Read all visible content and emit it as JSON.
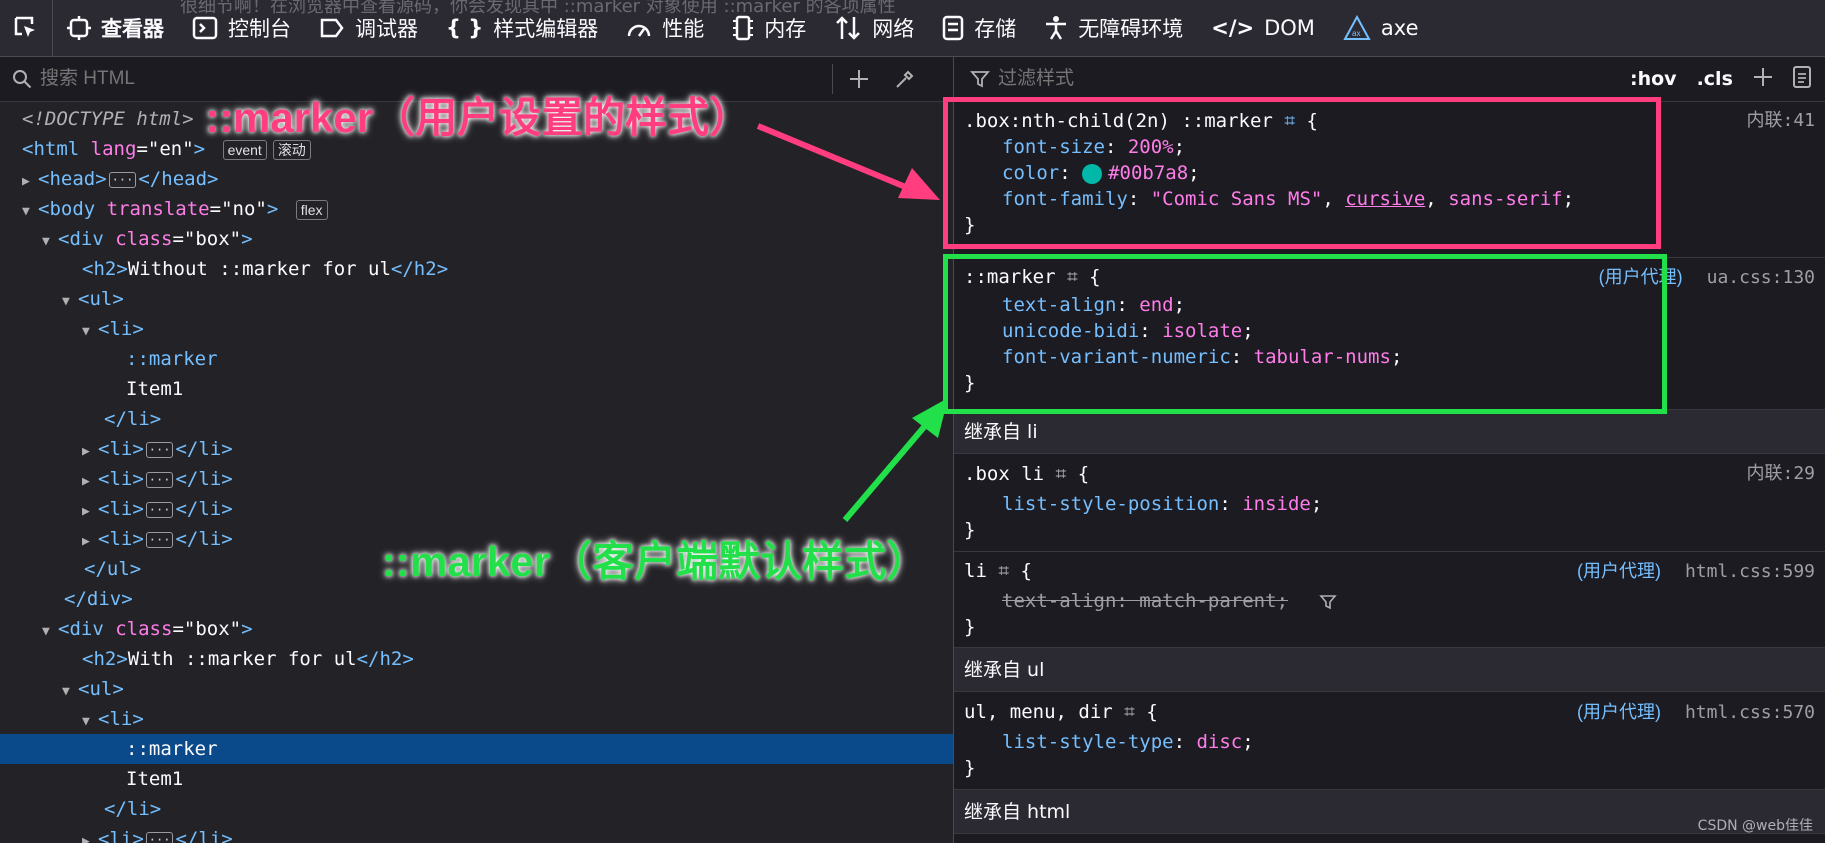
{
  "toolbar": {
    "tabs": [
      {
        "label": "查看器",
        "icon": "inspector-icon"
      },
      {
        "label": "控制台",
        "icon": "console-icon"
      },
      {
        "label": "调试器",
        "icon": "debugger-icon"
      },
      {
        "label": "样式编辑器",
        "icon": "braces-icon"
      },
      {
        "label": "性能",
        "icon": "performance-icon"
      },
      {
        "label": "内存",
        "icon": "memory-icon"
      },
      {
        "label": "网络",
        "icon": "network-icon"
      },
      {
        "label": "存储",
        "icon": "storage-icon"
      },
      {
        "label": "无障碍环境",
        "icon": "accessibility-icon"
      },
      {
        "label": "DOM",
        "icon": "dom-icon"
      },
      {
        "label": "axe",
        "icon": "axe-icon"
      }
    ],
    "overlay_text": "很细节啊！在浏览器中查看源码，你会发现其中 ::marker 对象使用 ::marker 的各项属性"
  },
  "left": {
    "search_placeholder": "搜索 HTML",
    "badges": {
      "event": "event",
      "scroll": "滚动",
      "flex": "flex"
    },
    "tree": {
      "doctype": "<!DOCTYPE html>",
      "html_tag": "html",
      "lang_attr": "lang",
      "lang_val": "\"en\"",
      "head_tag": "head",
      "body_tag": "body",
      "translate_attr": "translate",
      "translate_val": "\"no\"",
      "div_tag": "div",
      "class_attr": "class",
      "class_val": "\"box\"",
      "h2_tag": "h2",
      "h2_text1": "Without ::marker for ul",
      "h2_text2": "With ::marker for ul",
      "ul_tag": "ul",
      "li_tag": "li",
      "marker": "::marker",
      "item1": "Item1"
    }
  },
  "right": {
    "filter_placeholder": "过滤样式",
    "hov": ":hov",
    "cls": ".cls",
    "rules": {
      "r1_selector": ".box:nth-child(2n) ::marker",
      "r1_source": "内联:41",
      "r1_p1": "font-size",
      "r1_v1": "200%",
      "r1_p2": "color",
      "r1_v2": "#00b7a8",
      "r1_p3": "font-family",
      "r1_v3a": "\"Comic Sans MS\"",
      "r1_v3b": "cursive",
      "r1_v3c": "sans-serif",
      "r2_selector": "::marker",
      "r2_ua": "(用户代理)",
      "r2_source": "ua.css:130",
      "r2_p1": "text-align",
      "r2_v1": "end",
      "r2_p2": "unicode-bidi",
      "r2_v2": "isolate",
      "r2_p3": "font-variant-numeric",
      "r2_v3": "tabular-nums",
      "inherit_li": "继承自 li",
      "r3_selector": ".box li",
      "r3_source": "内联:29",
      "r3_p1": "list-style-position",
      "r3_v1": "inside",
      "r4_selector": "li",
      "r4_ua": "(用户代理)",
      "r4_source": "html.css:599",
      "r4_p1": "text-align",
      "r4_v1": "match-parent",
      "inherit_ul": "继承自 ul",
      "r5_selector": "ul, menu, dir",
      "r5_ua": "(用户代理)",
      "r5_source": "html.css:570",
      "r5_p1": "list-style-type",
      "r5_v1": "disc",
      "inherit_html": "继承自 html",
      "open_brace": "{",
      "close_brace": "}"
    }
  },
  "annotations": {
    "user_marker": "::marker（用户设置的样式）",
    "ua_marker": "::marker（客户端默认样式）",
    "user_color": "#ff3d7f",
    "ua_color": "#22e04a"
  },
  "colors": {
    "swatch": "#00b7a8",
    "selection": "#0b4a8a"
  },
  "watermark": "CSDN @web佳佳"
}
